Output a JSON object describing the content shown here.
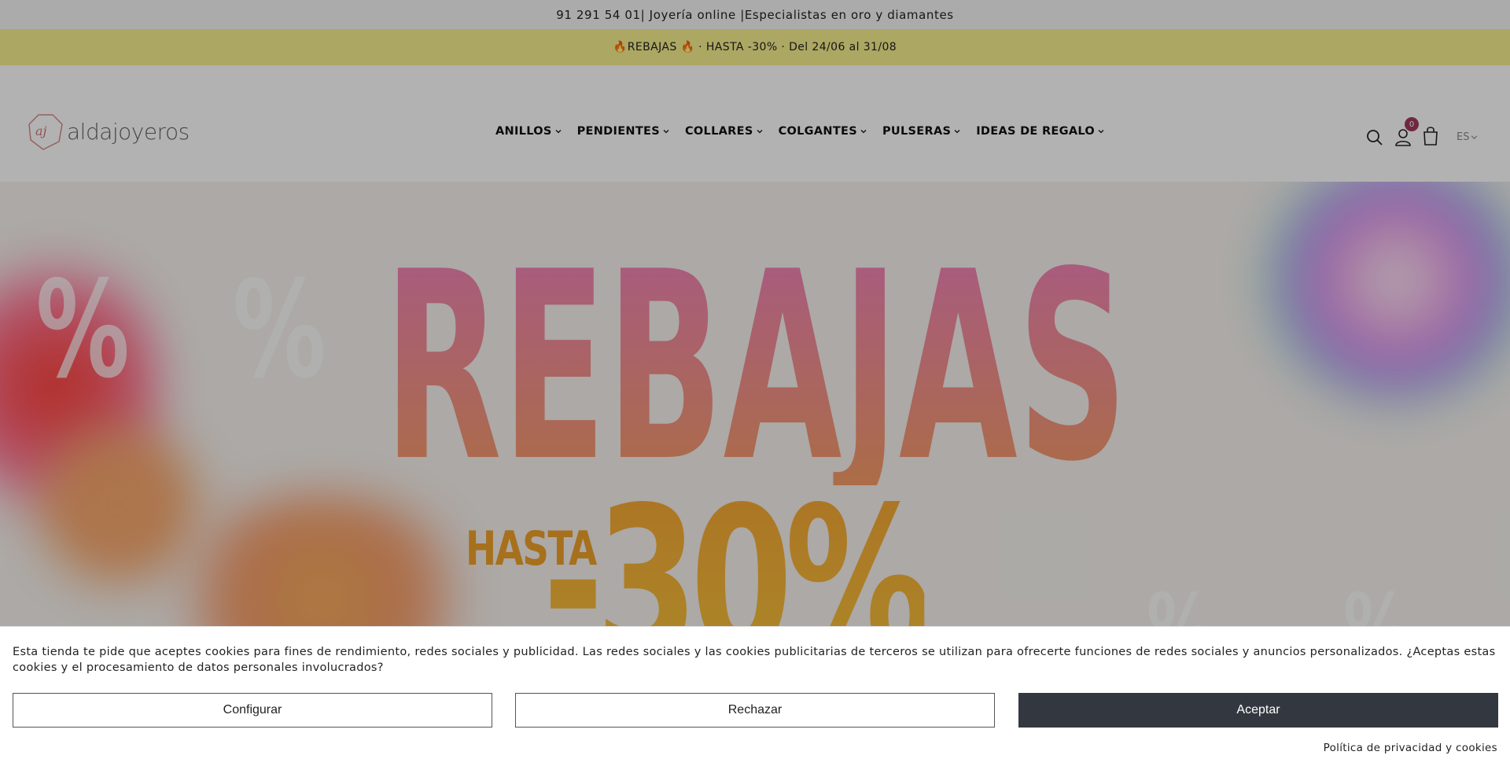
{
  "topbar": {
    "text": "91 291 54 01| Joyería online |Especialistas en oro y diamantes"
  },
  "promobar": {
    "text": "🔥REBAJAS 🔥 · HASTA -30% · Del 24/06 al 31/08"
  },
  "header": {
    "logo_text": "aldajoyeros",
    "logo_mark": "aj",
    "nav": [
      {
        "label": "ANILLOS"
      },
      {
        "label": "PENDIENTES"
      },
      {
        "label": "COLLARES"
      },
      {
        "label": "COLGANTES"
      },
      {
        "label": "PULSERAS"
      },
      {
        "label": "IDEAS DE REGALO"
      }
    ],
    "cart_count": "0",
    "language": "ES",
    "icons": [
      "search-icon",
      "user-icon",
      "cart-icon"
    ]
  },
  "hero": {
    "title": "REBAJAS",
    "subtitle": "HASTA",
    "discount": "-30%"
  },
  "cookie_banner": {
    "text": "Esta tienda te pide que aceptes cookies para fines de rendimiento, redes sociales y publicidad. Las redes sociales y las cookies publicitarias de terceros se utilizan para ofrecerte funciones de redes sociales y anuncios personalizados. ¿Aceptas estas cookies y el procesamiento de datos personales involucrados?",
    "configure_label": "Configurar",
    "reject_label": "Rechazar",
    "accept_label": "Aceptar",
    "policy_link": "Política de privacidad y cookies"
  },
  "colors": {
    "promo_bg": "#f6ef8e",
    "brand_accent": "#a03a5c",
    "accept_button": "#333840",
    "hero_title_pink": "#f27fc4",
    "hero_title_orange": "#f6a05a"
  }
}
